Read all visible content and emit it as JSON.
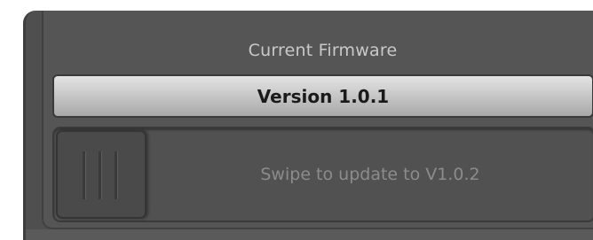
{
  "firmware": {
    "title": "Current Firmware",
    "version": "Version 1.0.1"
  },
  "update": {
    "swipe_label": "Swipe to update to V1.0.2",
    "handle_icon": "grip-lines-icon"
  },
  "colors": {
    "panel": "#555555",
    "pill_light": "#e4e4e4",
    "pill_dark": "#a8a8a8",
    "swipe_text": "#8c8c8c"
  }
}
